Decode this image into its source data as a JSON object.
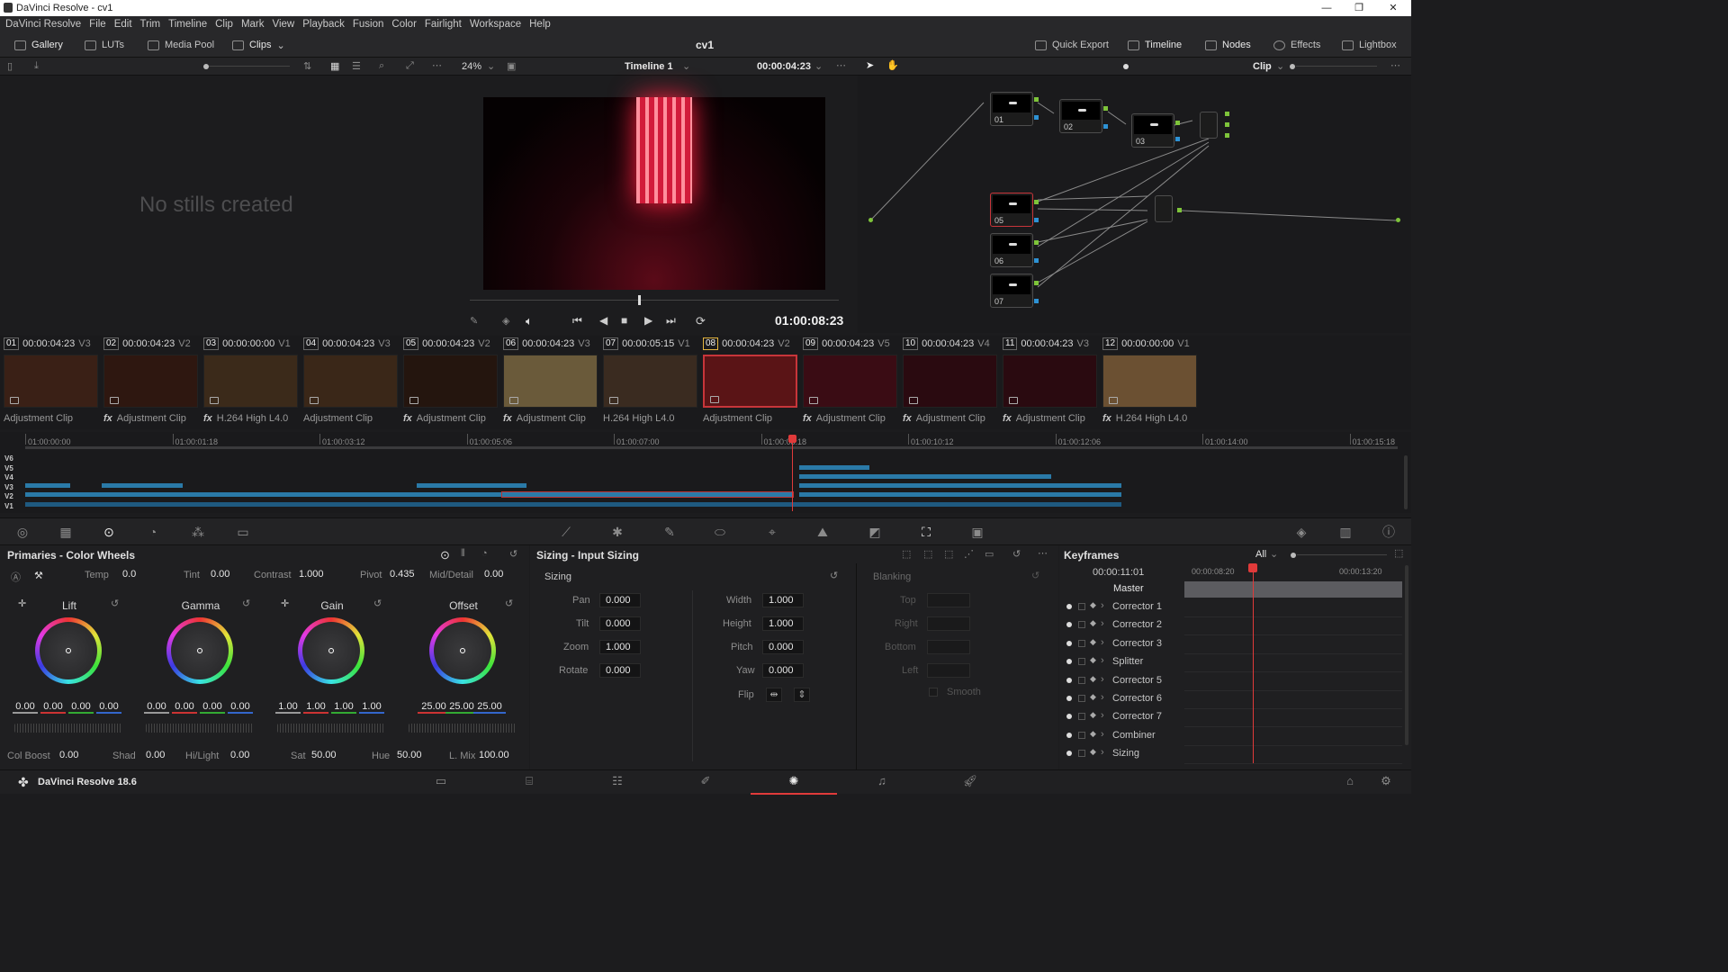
{
  "app": {
    "window_title": "DaVinci Resolve - cv1",
    "project_name": "cv1",
    "version_label": "DaVinci Resolve 18.6"
  },
  "window_controls": {
    "minimize": "—",
    "maximize": "❐",
    "close": "✕"
  },
  "menu": [
    "DaVinci Resolve",
    "File",
    "Edit",
    "Trim",
    "Timeline",
    "Clip",
    "Mark",
    "View",
    "Playback",
    "Fusion",
    "Color",
    "Fairlight",
    "Workspace",
    "Help"
  ],
  "toolbar": {
    "gallery": "Gallery",
    "luts": "LUTs",
    "media_pool": "Media Pool",
    "clips": "Clips",
    "quick_export": "Quick Export",
    "timeline": "Timeline",
    "nodes": "Nodes",
    "effects": "Effects",
    "lightbox": "Lightbox"
  },
  "viewer_bar": {
    "zoom": "24%",
    "timeline_name": "Timeline 1",
    "timecode": "00:00:04:23",
    "clip_mode": "Clip"
  },
  "gallery": {
    "empty_message": "No stills created"
  },
  "viewer": {
    "playback_timecode": "01:00:08:23"
  },
  "nodes": [
    {
      "label": "01"
    },
    {
      "label": "02"
    },
    {
      "label": "03"
    },
    {
      "label": "05"
    },
    {
      "label": "06"
    },
    {
      "label": "07"
    }
  ],
  "clips": [
    {
      "num": "01",
      "tc": "00:00:04:23",
      "track": "V3",
      "name": "Adjustment Clip",
      "fx": false,
      "selected": false
    },
    {
      "num": "02",
      "tc": "00:00:04:23",
      "track": "V2",
      "name": "Adjustment Clip",
      "fx": true,
      "selected": false
    },
    {
      "num": "03",
      "tc": "00:00:00:00",
      "track": "V1",
      "name": "H.264 High L4.0",
      "fx": true,
      "selected": false
    },
    {
      "num": "04",
      "tc": "00:00:04:23",
      "track": "V3",
      "name": "Adjustment Clip",
      "fx": false,
      "selected": false
    },
    {
      "num": "05",
      "tc": "00:00:04:23",
      "track": "V2",
      "name": "Adjustment Clip",
      "fx": true,
      "selected": false
    },
    {
      "num": "06",
      "tc": "00:00:04:23",
      "track": "V3",
      "name": "Adjustment Clip",
      "fx": true,
      "selected": false
    },
    {
      "num": "07",
      "tc": "00:00:05:15",
      "track": "V1",
      "name": "H.264 High L4.0",
      "fx": false,
      "selected": false
    },
    {
      "num": "08",
      "tc": "00:00:04:23",
      "track": "V2",
      "name": "Adjustment Clip",
      "fx": false,
      "selected": true
    },
    {
      "num": "09",
      "tc": "00:00:04:23",
      "track": "V5",
      "name": "Adjustment Clip",
      "fx": true,
      "selected": false
    },
    {
      "num": "10",
      "tc": "00:00:04:23",
      "track": "V4",
      "name": "Adjustment Clip",
      "fx": true,
      "selected": false
    },
    {
      "num": "11",
      "tc": "00:00:04:23",
      "track": "V3",
      "name": "Adjustment Clip",
      "fx": true,
      "selected": false
    },
    {
      "num": "12",
      "tc": "00:00:00:00",
      "track": "V1",
      "name": "H.264 High L4.0",
      "fx": true,
      "selected": false
    }
  ],
  "timeline": {
    "ruler": [
      "01:00:00:00",
      "01:00:01:18",
      "01:00:03:12",
      "01:00:05:06",
      "01:00:07:00",
      "01:00:08:18",
      "01:00:10:12",
      "01:00:12:06",
      "01:00:14:00",
      "01:00:15:18"
    ],
    "tracks": [
      "V6",
      "V5",
      "V4",
      "V3",
      "V2",
      "V1"
    ]
  },
  "primaries": {
    "title": "Primaries - Color Wheels",
    "temp_label": "Temp",
    "temp": "0.0",
    "tint_label": "Tint",
    "tint": "0.00",
    "contrast_label": "Contrast",
    "contrast": "1.000",
    "pivot_label": "Pivot",
    "pivot": "0.435",
    "middetail_label": "Mid/Detail",
    "middetail": "0.00",
    "wheels": [
      {
        "name": "Lift",
        "values": [
          "0.00",
          "0.00",
          "0.00",
          "0.00"
        ]
      },
      {
        "name": "Gamma",
        "values": [
          "0.00",
          "0.00",
          "0.00",
          "0.00"
        ]
      },
      {
        "name": "Gain",
        "values": [
          "1.00",
          "1.00",
          "1.00",
          "1.00"
        ]
      },
      {
        "name": "Offset",
        "values": [
          "25.00",
          "25.00",
          "25.00"
        ]
      }
    ],
    "colboost_label": "Col Boost",
    "colboost": "0.00",
    "shad_label": "Shad",
    "shad": "0.00",
    "hilight_label": "Hi/Light",
    "hilight": "0.00",
    "sat_label": "Sat",
    "sat": "50.00",
    "hue_label": "Hue",
    "hue": "50.00",
    "lmix_label": "L. Mix",
    "lmix": "100.00"
  },
  "sizing": {
    "title": "Sizing - Input Sizing",
    "section": "Sizing",
    "pan_label": "Pan",
    "pan": "0.000",
    "tilt_label": "Tilt",
    "tilt": "0.000",
    "zoom_label": "Zoom",
    "zoom": "1.000",
    "rotate_label": "Rotate",
    "rotate": "0.000",
    "width_label": "Width",
    "width": "1.000",
    "height_label": "Height",
    "height": "1.000",
    "pitch_label": "Pitch",
    "pitch": "0.000",
    "yaw_label": "Yaw",
    "yaw": "0.000",
    "flip_label": "Flip",
    "blanking": "Blanking",
    "top": "Top",
    "right": "Right",
    "bottom": "Bottom",
    "left": "Left",
    "smooth": "Smooth"
  },
  "keyframes": {
    "title": "Keyframes",
    "filter": "All",
    "timecode": "00:00:11:01",
    "ruler_a": "00:00:08:20",
    "ruler_b": "00:00:13:20",
    "master": "Master",
    "items": [
      "Corrector 1",
      "Corrector 2",
      "Corrector 3",
      "Splitter",
      "Corrector 5",
      "Corrector 6",
      "Corrector 7",
      "Combiner",
      "Sizing"
    ]
  }
}
